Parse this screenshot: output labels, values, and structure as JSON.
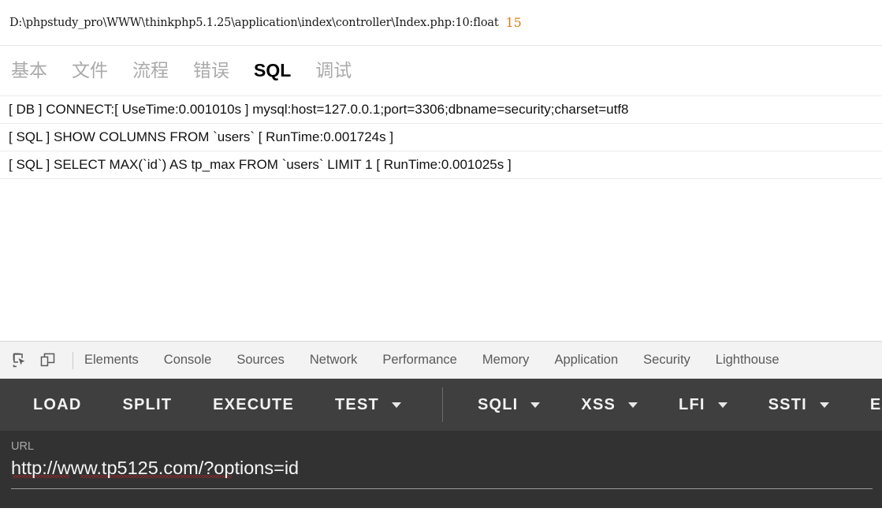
{
  "trace": {
    "path": "D:\\phpstudy_pro\\WWW\\thinkphp5.1.25\\application\\index\\controller\\Index.php:10:float",
    "value": "15",
    "value_color": "#e07b11"
  },
  "tabs": [
    {
      "label": "基本",
      "active": false
    },
    {
      "label": "文件",
      "active": false
    },
    {
      "label": "流程",
      "active": false
    },
    {
      "label": "错误",
      "active": false
    },
    {
      "label": "SQL",
      "active": true
    },
    {
      "label": "调试",
      "active": false
    }
  ],
  "sql_log": {
    "rows": [
      "[ DB ] CONNECT:[ UseTime:0.001010s ] mysql:host=127.0.0.1;port=3306;dbname=security;charset=utf8",
      "[ SQL ] SHOW COLUMNS FROM `users` [ RunTime:0.001724s ]",
      "[ SQL ] SELECT MAX(`id`) AS tp_max FROM `users` LIMIT 1 [ RunTime:0.001025s ]"
    ]
  },
  "devtools": {
    "icons": [
      {
        "name": "inspect-element-icon"
      },
      {
        "name": "device-toolbar-icon"
      }
    ],
    "tabs": [
      {
        "label": "Elements"
      },
      {
        "label": "Console"
      },
      {
        "label": "Sources"
      },
      {
        "label": "Network"
      },
      {
        "label": "Performance"
      },
      {
        "label": "Memory"
      },
      {
        "label": "Application"
      },
      {
        "label": "Security"
      },
      {
        "label": "Lighthouse"
      }
    ]
  },
  "action_toolbar": {
    "background": "#403f3f",
    "items": [
      {
        "label": "LOAD",
        "has_dropdown": false
      },
      {
        "label": "SPLIT",
        "has_dropdown": false
      },
      {
        "label": "EXECUTE",
        "has_dropdown": false
      },
      {
        "label": "TEST",
        "has_dropdown": true
      },
      {
        "label": "SQLI",
        "has_dropdown": true
      },
      {
        "label": "XSS",
        "has_dropdown": true
      },
      {
        "label": "LFI",
        "has_dropdown": true
      },
      {
        "label": "SSTI",
        "has_dropdown": true
      },
      {
        "label": "ENC",
        "has_dropdown": false
      }
    ]
  },
  "url_panel": {
    "label": "URL",
    "value": "http://www.tp5125.com/?options=id",
    "background": "#333233"
  }
}
